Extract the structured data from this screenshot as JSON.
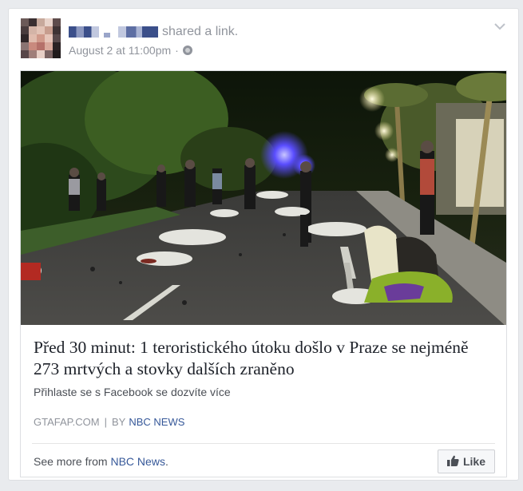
{
  "post": {
    "action_text": "shared a link.",
    "timestamp": "August 2 at 11:00pm",
    "timestamp_separator": "·",
    "privacy_icon": "globe-icon",
    "menu_icon": "chevron-down-icon"
  },
  "link": {
    "title": "Před 30 minut: 1 teroristického útoku došlo v Praze se nejméně 273 mrtvých a stovky dalších zraněno",
    "description": "Přihlaste se s Facebook se dozvíte více",
    "domain": "GTAFAP.COM",
    "separator": "|",
    "by_label": "BY",
    "author": "NBC NEWS"
  },
  "footer": {
    "see_more_prefix": "See more from ",
    "see_more_link": "NBC News",
    "see_more_suffix": ".",
    "like_label": "Like",
    "like_icon": "thumbs-up-icon"
  },
  "colors": {
    "link_blue": "#365899",
    "meta_gray": "#90949c",
    "text_dark": "#1d2129"
  }
}
